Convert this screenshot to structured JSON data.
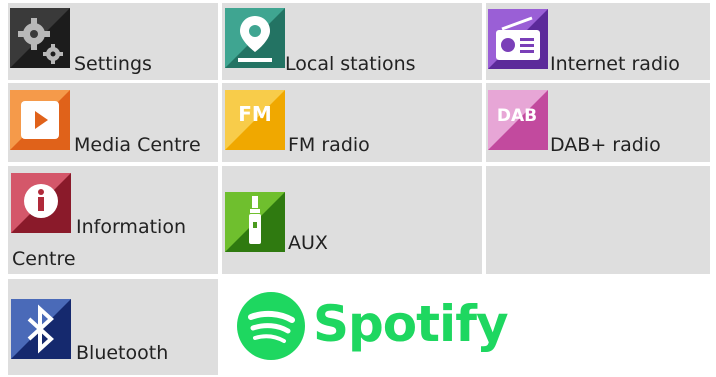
{
  "tiles": {
    "settings": {
      "label": "Settings",
      "icon": "settings-gears-icon"
    },
    "local_stations": {
      "label": "Local stations",
      "icon": "map-pin-icon"
    },
    "internet_radio": {
      "label": "Internet radio",
      "icon": "radio-icon"
    },
    "media_centre": {
      "label": "Media Centre",
      "icon": "play-icon"
    },
    "fm_radio": {
      "label": "FM radio",
      "icon": "fm-icon",
      "badge": "FM"
    },
    "dab_radio": {
      "label": "DAB+ radio",
      "icon": "dab-icon",
      "badge": "DAB"
    },
    "information_centre": {
      "label_line1": "Information",
      "label_line2": "Centre",
      "icon": "info-icon"
    },
    "aux": {
      "label": "AUX",
      "icon": "jack-plug-icon"
    },
    "bluetooth": {
      "label": "Bluetooth",
      "icon": "bluetooth-icon"
    },
    "spotify": {
      "label": "Spotify",
      "icon": "spotify-logo-icon"
    }
  },
  "colors": {
    "tile_bg": "#dedede",
    "settings": "#2b2b2b",
    "local_stations": "#2f8a7a",
    "internet_radio": "#7a3fb8",
    "media_centre": "#f07a2a",
    "fm_radio": "#f5b81a",
    "dab_radio": "#c94fa8",
    "information_centre": "#b02a3a",
    "aux": "#4a9a1e",
    "bluetooth": "#1f3a8a",
    "spotify": "#1ed760"
  }
}
